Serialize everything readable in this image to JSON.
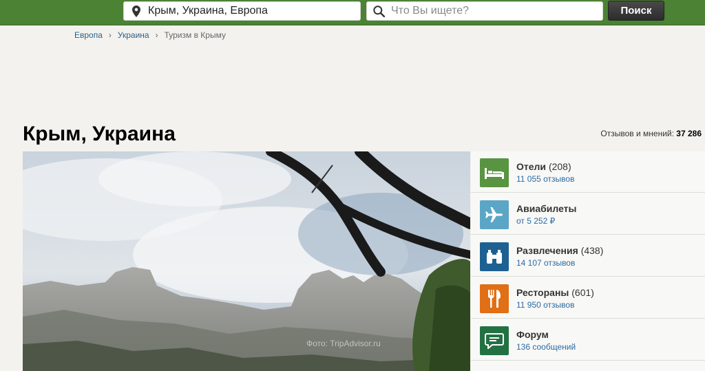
{
  "header": {
    "location_value": "Крым, Украина, Европа",
    "search_placeholder": "Что Вы ищете?",
    "search_button": "Поиск"
  },
  "breadcrumbs": [
    {
      "label": "Европа"
    },
    {
      "label": "Украина"
    },
    {
      "label": "Туризм в Крыму"
    }
  ],
  "breadcrumb_separator": "›",
  "page": {
    "title": "Крым, Украина",
    "reviews_label": "Отзывов и мнений:",
    "reviews_count": "37 286"
  },
  "hero": {
    "watermark": "Фото: TripAdvisor.ru"
  },
  "categories": [
    {
      "name": "Отели",
      "count": "(208)",
      "sub": "11 055 отзывов",
      "icon": "bed-icon",
      "color": "#589442"
    },
    {
      "name": "Авиабилеты",
      "count": "",
      "sub": "от 5 252 ₽",
      "icon": "airplane-icon",
      "color": "#5ba6c6"
    },
    {
      "name": "Развлечения",
      "count": "(438)",
      "sub": "14 107 отзывов",
      "icon": "binoculars-icon",
      "color": "#1d6193"
    },
    {
      "name": "Рестораны",
      "count": "(601)",
      "sub": "11 950 отзывов",
      "icon": "fork-knife-icon",
      "color": "#e06f16"
    },
    {
      "name": "Форум",
      "count": "",
      "sub": "136 сообщений",
      "icon": "chat-bubble-icon",
      "color": "#237143"
    }
  ]
}
